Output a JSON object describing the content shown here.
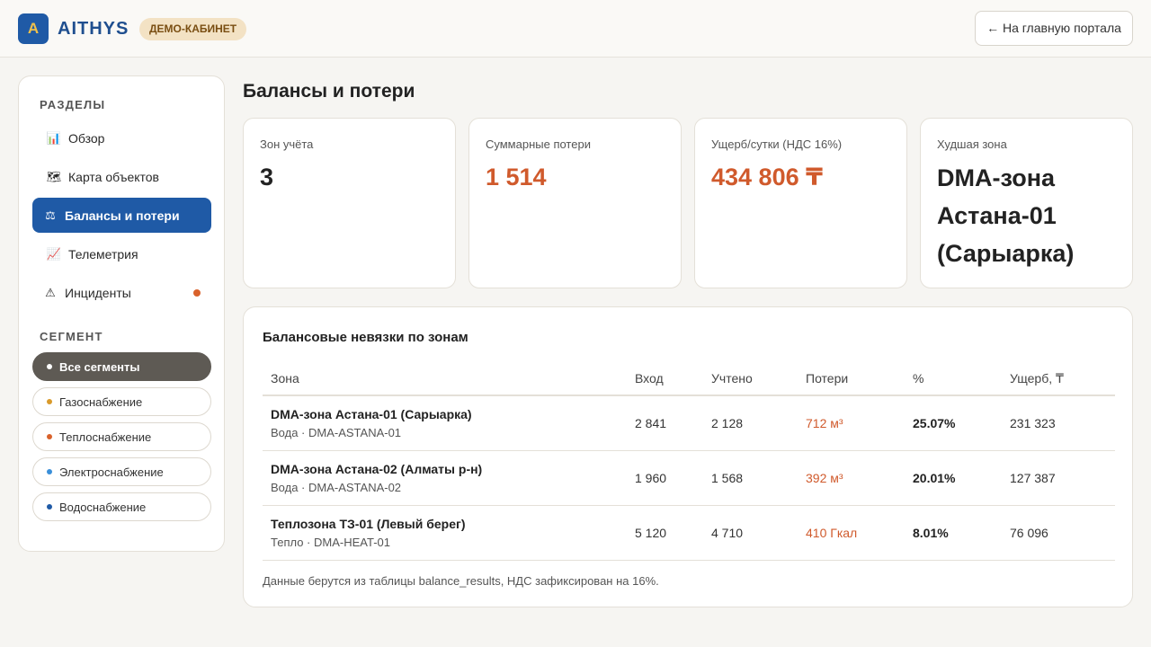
{
  "header": {
    "logo_letter": "A",
    "brand": "AITHYS",
    "badge": "ДЕМО-КАБИНЕТ",
    "home_button": "← На главную портала"
  },
  "sidebar": {
    "sections_title": "РАЗДЕЛЫ",
    "items": [
      {
        "label": "Обзор",
        "icon": "bar-chart-icon",
        "glyph": "📊"
      },
      {
        "label": "Карта объектов",
        "icon": "world-map-icon",
        "glyph": "🗺"
      },
      {
        "label": "Балансы и потери",
        "icon": "scales-icon",
        "glyph": "⚖"
      },
      {
        "label": "Телеметрия",
        "icon": "line-chart-icon",
        "glyph": "📈"
      },
      {
        "label": "Инциденты",
        "icon": "warning-icon",
        "glyph": "⚠"
      }
    ],
    "active_item": "Балансы и потери",
    "segment_title": "СЕГМЕНТ",
    "segments": [
      {
        "label": "Все сегменты",
        "dot": "#ffffff"
      },
      {
        "label": "Газоснабжение",
        "dot": "#d99a2b"
      },
      {
        "label": "Теплоснабжение",
        "dot": "#d9622b"
      },
      {
        "label": "Электроснабжение",
        "dot": "#3a8fd9"
      },
      {
        "label": "Водоснабжение",
        "dot": "#1f5aa6"
      }
    ]
  },
  "main": {
    "title": "Балансы и потери",
    "kpis": [
      {
        "label": "Зон учёта",
        "value": "3"
      },
      {
        "label": "Суммарные потери",
        "value": "1 514"
      },
      {
        "label": "Ущерб/сутки (НДС 16%)",
        "value": "434 806 ₸"
      },
      {
        "label": "Худшая зона",
        "value": "DMA-зона Астана-01 (Сарыарка)"
      }
    ],
    "table": {
      "title": "Балансовые невязки по зонам",
      "headers": [
        "Зона",
        "Вход",
        "Учтено",
        "Потери",
        "%",
        "Ущерб, ₸"
      ],
      "rows": [
        {
          "zone": "DMA-зона Астана-01 (Сарыарка)",
          "sub": "Вода · DMA-ASTANA-01",
          "input": "2 841",
          "accounted": "2 128",
          "loss": "712 м³",
          "pct": "25.07%",
          "damage": "231 323"
        },
        {
          "zone": "DMA-зона Астана-02 (Алматы р-н)",
          "sub": "Вода · DMA-ASTANA-02",
          "input": "1 960",
          "accounted": "1 568",
          "loss": "392 м³",
          "pct": "20.01%",
          "damage": "127 387"
        },
        {
          "zone": "Теплозона ТЗ-01 (Левый берег)",
          "sub": "Тепло · DMA-HEAT-01",
          "input": "5 120",
          "accounted": "4 710",
          "loss": "410 Гкал",
          "pct": "8.01%",
          "damage": "76 096"
        }
      ],
      "footnote": "Данные берутся из таблицы balance_results, НДС зафиксирован на 16%."
    }
  },
  "colors": {
    "accent": "#1f5aa6",
    "loss": "#d05a2c",
    "background": "#f6f5f2"
  }
}
